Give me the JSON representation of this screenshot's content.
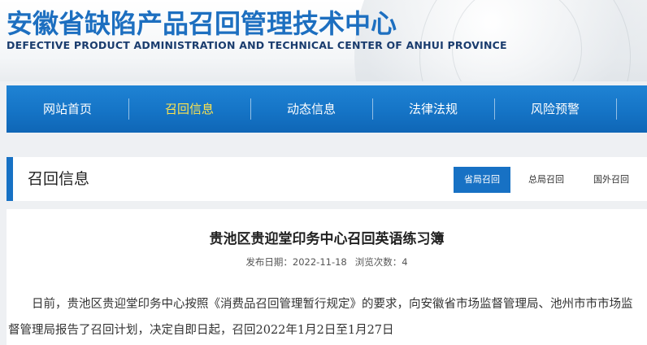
{
  "header": {
    "title": "安徽省缺陷产品召回管理技术中心",
    "subtitle": "DEFECTIVE PRODUCT ADMINISTRATION AND TECHNICAL CENTER OF ANHUI PROVINCE"
  },
  "nav": {
    "items": [
      {
        "label": "网站首页",
        "active": false
      },
      {
        "label": "召回信息",
        "active": true
      },
      {
        "label": "动态信息",
        "active": false
      },
      {
        "label": "法律法规",
        "active": false
      },
      {
        "label": "风险预警",
        "active": false
      }
    ]
  },
  "section": {
    "title": "召回信息",
    "tabs": [
      {
        "label": "省局召回",
        "active": true
      },
      {
        "label": "总局召回",
        "active": false
      },
      {
        "label": "国外召回",
        "active": false
      }
    ]
  },
  "article": {
    "title": "贵池区贵迎堂印务中心召回英语练习簿",
    "publish_label": "发布日期：",
    "publish_date": "2022-11-18",
    "views_label": "浏览次数：",
    "views": "4",
    "body": "日前，贵池区贵迎堂印务中心按照《消费品召回管理暂行规定》的要求，向安徽省市场监督管理局、池州市市市场监督管理局报告了召回计划，决定自即日起，召回2022年1月2日至1月27日"
  },
  "colors": {
    "brand_blue": "#1d6fc0",
    "nav_blue": "#1574c6",
    "active_nav_text": "#ffe44d",
    "tab_active_bg": "#1771c4"
  }
}
